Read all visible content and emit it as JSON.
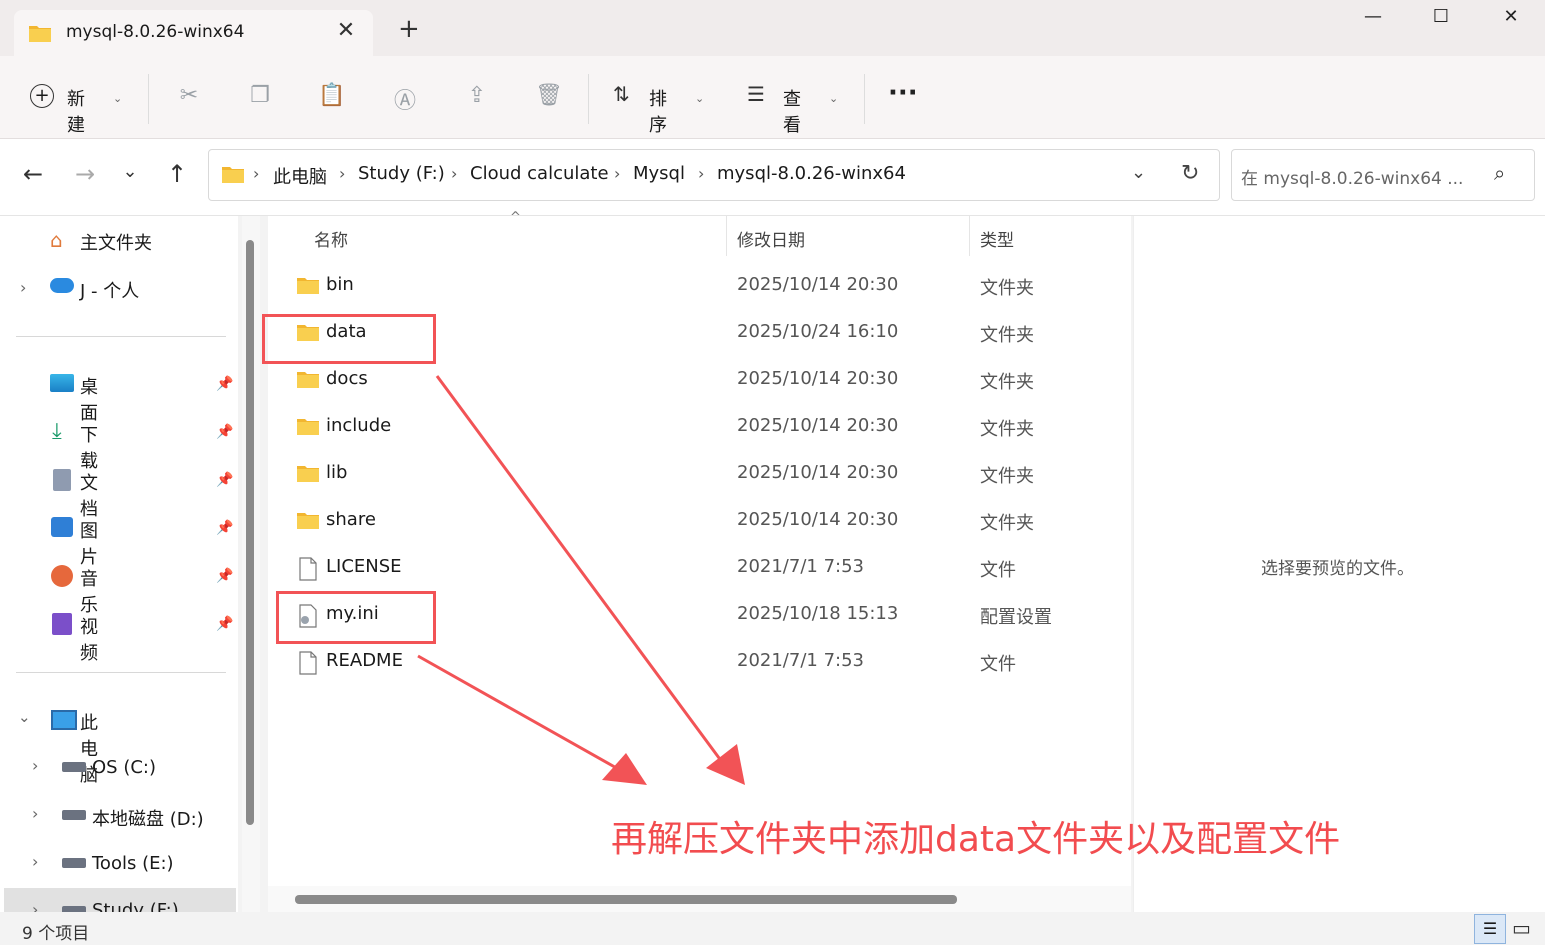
{
  "window": {
    "tab_title": "mysql-8.0.26-winx64",
    "tab_close": "✕",
    "new_tab": "+",
    "minimize": "—",
    "maximize": "☐",
    "close": "✕"
  },
  "toolbar": {
    "new_label": "新建",
    "sort_label": "排序",
    "view_label": "查看",
    "more_label": "···"
  },
  "address": {
    "crumbs": [
      "此电脑",
      "Study (F:)",
      "Cloud calculate",
      "Mysql",
      "mysql-8.0.26-winx64"
    ],
    "search_placeholder": "在 mysql-8.0.26-winx64 ..."
  },
  "sidebar": {
    "home": "主文件夹",
    "cloud": "J - 个人",
    "pinned": [
      "桌面",
      "下载",
      "文档",
      "图片",
      "音乐",
      "视频"
    ],
    "thispc": "此电脑",
    "drives": [
      "OS (C:)",
      "本地磁盘 (D:)",
      "Tools (E:)",
      "Study (F:)"
    ]
  },
  "columns": {
    "name": "名称",
    "modified": "修改日期",
    "type": "类型"
  },
  "files": [
    {
      "name": "bin",
      "date": "2025/10/14 20:30",
      "type": "文件夹",
      "kind": "folder"
    },
    {
      "name": "data",
      "date": "2025/10/24 16:10",
      "type": "文件夹",
      "kind": "folder"
    },
    {
      "name": "docs",
      "date": "2025/10/14 20:30",
      "type": "文件夹",
      "kind": "folder"
    },
    {
      "name": "include",
      "date": "2025/10/14 20:30",
      "type": "文件夹",
      "kind": "folder"
    },
    {
      "name": "lib",
      "date": "2025/10/14 20:30",
      "type": "文件夹",
      "kind": "folder"
    },
    {
      "name": "share",
      "date": "2025/10/14 20:30",
      "type": "文件夹",
      "kind": "folder"
    },
    {
      "name": "LICENSE",
      "date": "2021/7/1 7:53",
      "type": "文件",
      "kind": "file"
    },
    {
      "name": "my.ini",
      "date": "2025/10/18 15:13",
      "type": "配置设置",
      "kind": "config"
    },
    {
      "name": "README",
      "date": "2021/7/1 7:53",
      "type": "文件",
      "kind": "file"
    }
  ],
  "preview": {
    "text": "选择要预览的文件。"
  },
  "status": {
    "count": "9 个项目"
  },
  "annotation": {
    "text": "再解压文件夹中添加data文件夹以及配置文件",
    "color": "#f24c4f"
  },
  "colors": {
    "folder": "#f7c948",
    "accent": "#0067c0",
    "annotation_red": "#f25356"
  }
}
